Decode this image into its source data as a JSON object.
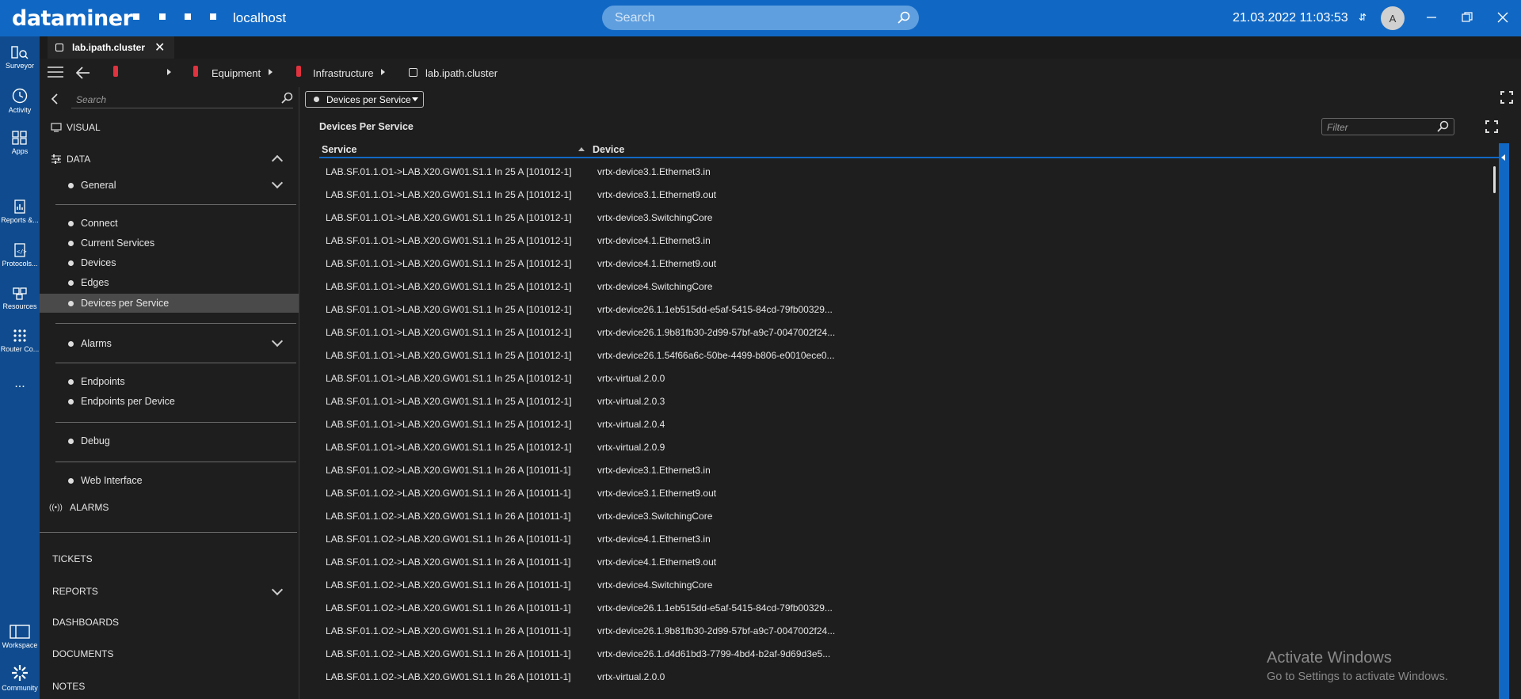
{
  "app": {
    "logo": "dataminer",
    "host": "localhost",
    "search_placeholder": "Search",
    "datetime": "21.03.2022 11:03:53",
    "avatar_initial": "A"
  },
  "rail": [
    {
      "label": "Surveyor",
      "icon": "surveyor-icon"
    },
    {
      "label": "Activity",
      "icon": "activity-icon"
    },
    {
      "label": "Apps",
      "icon": "apps-icon"
    },
    {
      "label": "Reports &...",
      "icon": "reports-icon"
    },
    {
      "label": "Protocols...",
      "icon": "protocols-icon"
    },
    {
      "label": "Resources",
      "icon": "resources-icon"
    },
    {
      "label": "Router Co...",
      "icon": "router-control-icon"
    },
    {
      "label": "...",
      "icon": "more-icon"
    },
    {
      "label": "Workspace",
      "icon": "workspace-icon"
    },
    {
      "label": "Community",
      "icon": "community-icon"
    }
  ],
  "tab": {
    "label": "lab.ipath.cluster"
  },
  "breadcrumb": {
    "equipment": "Equipment",
    "infrastructure": "Infrastructure",
    "cluster": "lab.ipath.cluster"
  },
  "sidepanel": {
    "search_placeholder": "Search",
    "visual": "VISUAL",
    "data": "DATA",
    "general": "General",
    "items": [
      "Connect",
      "Current Services",
      "Devices",
      "Edges",
      "Devices per Service"
    ],
    "alarms_group": "Alarms",
    "endpoints": [
      "Endpoints",
      "Endpoints per Device"
    ],
    "debug": "Debug",
    "web_interface": "Web Interface",
    "alarms": "ALARMS",
    "tickets": "TICKETS",
    "reports": "REPORTS",
    "dashboards": "DASHBOARDS",
    "documents": "DOCUMENTS",
    "notes": "NOTES"
  },
  "main": {
    "dropdown_value": "Devices per Service",
    "component_title": "Devices Per Service",
    "filter_placeholder": "Filter",
    "columns": [
      "Service",
      "Device"
    ],
    "rows": [
      [
        "LAB.SF.01.1.O1->LAB.X20.GW01.S1.1 In 25 A [101012-1]",
        "vrtx-device3.1.Ethernet3.in"
      ],
      [
        "LAB.SF.01.1.O1->LAB.X20.GW01.S1.1 In 25 A [101012-1]",
        "vrtx-device3.1.Ethernet9.out"
      ],
      [
        "LAB.SF.01.1.O1->LAB.X20.GW01.S1.1 In 25 A [101012-1]",
        "vrtx-device3.SwitchingCore"
      ],
      [
        "LAB.SF.01.1.O1->LAB.X20.GW01.S1.1 In 25 A [101012-1]",
        "vrtx-device4.1.Ethernet3.in"
      ],
      [
        "LAB.SF.01.1.O1->LAB.X20.GW01.S1.1 In 25 A [101012-1]",
        "vrtx-device4.1.Ethernet9.out"
      ],
      [
        "LAB.SF.01.1.O1->LAB.X20.GW01.S1.1 In 25 A [101012-1]",
        "vrtx-device4.SwitchingCore"
      ],
      [
        "LAB.SF.01.1.O1->LAB.X20.GW01.S1.1 In 25 A [101012-1]",
        "vrtx-device26.1.1eb515dd-e5af-5415-84cd-79fb00329..."
      ],
      [
        "LAB.SF.01.1.O1->LAB.X20.GW01.S1.1 In 25 A [101012-1]",
        "vrtx-device26.1.9b81fb30-2d99-57bf-a9c7-0047002f24..."
      ],
      [
        "LAB.SF.01.1.O1->LAB.X20.GW01.S1.1 In 25 A [101012-1]",
        "vrtx-device26.1.54f66a6c-50be-4499-b806-e0010ece0..."
      ],
      [
        "LAB.SF.01.1.O1->LAB.X20.GW01.S1.1 In 25 A [101012-1]",
        "vrtx-virtual.2.0.0"
      ],
      [
        "LAB.SF.01.1.O1->LAB.X20.GW01.S1.1 In 25 A [101012-1]",
        "vrtx-virtual.2.0.3"
      ],
      [
        "LAB.SF.01.1.O1->LAB.X20.GW01.S1.1 In 25 A [101012-1]",
        "vrtx-virtual.2.0.4"
      ],
      [
        "LAB.SF.01.1.O1->LAB.X20.GW01.S1.1 In 25 A [101012-1]",
        "vrtx-virtual.2.0.9"
      ],
      [
        "LAB.SF.01.1.O2->LAB.X20.GW01.S1.1 In 26 A [101011-1]",
        "vrtx-device3.1.Ethernet3.in"
      ],
      [
        "LAB.SF.01.1.O2->LAB.X20.GW01.S1.1 In 26 A [101011-1]",
        "vrtx-device3.1.Ethernet9.out"
      ],
      [
        "LAB.SF.01.1.O2->LAB.X20.GW01.S1.1 In 26 A [101011-1]",
        "vrtx-device3.SwitchingCore"
      ],
      [
        "LAB.SF.01.1.O2->LAB.X20.GW01.S1.1 In 26 A [101011-1]",
        "vrtx-device4.1.Ethernet3.in"
      ],
      [
        "LAB.SF.01.1.O2->LAB.X20.GW01.S1.1 In 26 A [101011-1]",
        "vrtx-device4.1.Ethernet9.out"
      ],
      [
        "LAB.SF.01.1.O2->LAB.X20.GW01.S1.1 In 26 A [101011-1]",
        "vrtx-device4.SwitchingCore"
      ],
      [
        "LAB.SF.01.1.O2->LAB.X20.GW01.S1.1 In 26 A [101011-1]",
        "vrtx-device26.1.1eb515dd-e5af-5415-84cd-79fb00329..."
      ],
      [
        "LAB.SF.01.1.O2->LAB.X20.GW01.S1.1 In 26 A [101011-1]",
        "vrtx-device26.1.9b81fb30-2d99-57bf-a9c7-0047002f24..."
      ],
      [
        "LAB.SF.01.1.O2->LAB.X20.GW01.S1.1 In 26 A [101011-1]",
        "vrtx-device26.1.d4d61bd3-7799-4bd4-b2af-9d69d3e5..."
      ],
      [
        "LAB.SF.01.1.O2->LAB.X20.GW01.S1.1 In 26 A [101011-1]",
        "vrtx-virtual.2.0.0"
      ]
    ]
  },
  "watermark": {
    "line1": "Activate Windows",
    "line2": "Go to Settings to activate Windows."
  },
  "colors": {
    "topbar": "#1168c4",
    "rail": "#0f4b8e",
    "accent_red": "#e0323f"
  }
}
